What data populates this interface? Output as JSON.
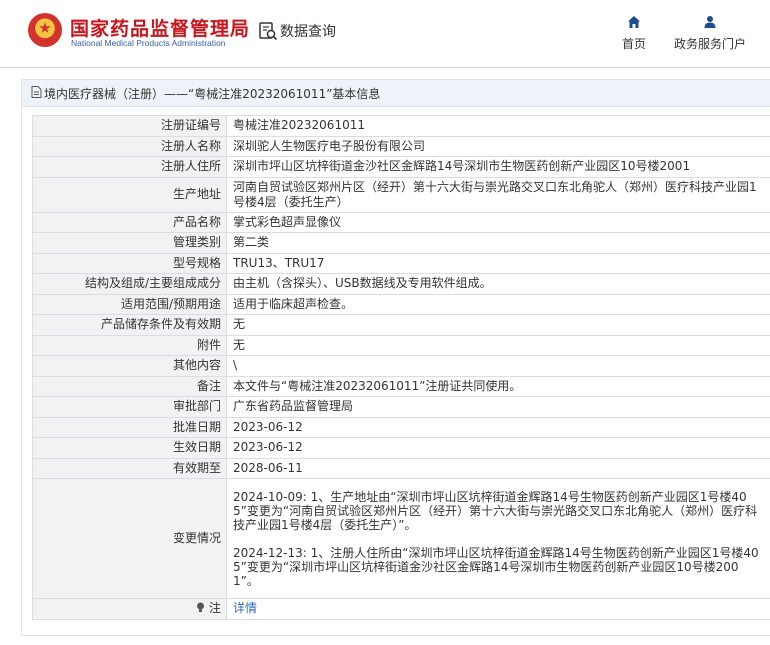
{
  "header": {
    "brand_cn": "国家药品监督管理局",
    "brand_en": "National Medical Products Administration",
    "query_label": "数据查询",
    "nav": [
      {
        "label": "首页",
        "icon": "home-icon"
      },
      {
        "label": "政务服务门户",
        "icon": "user-icon"
      }
    ]
  },
  "colors": {
    "brand_red": "#c8161e",
    "brand_blue": "#3a5fa8",
    "link": "#2f6bb4",
    "panel_head_bg": "#eef3f9",
    "key_bg": "#f2f2f2"
  },
  "panel": {
    "title": "境内医疗器械（注册）——“粤械注准20232061011”基本信息"
  },
  "detail": {
    "rows": [
      {
        "key": "注册证编号",
        "value": "粤械注准20232061011"
      },
      {
        "key": "注册人名称",
        "value": "深圳驼人生物医疗电子股份有限公司"
      },
      {
        "key": "注册人住所",
        "value": "深圳市坪山区坑梓街道金沙社区金辉路14号深圳市生物医药创新产业园区10号楼2001"
      },
      {
        "key": "生产地址",
        "value": "河南自贸试验区郑州片区（经开）第十六大街与崇光路交叉口东北角驼人（郑州）医疗科技产业园1号楼4层（委托生产）"
      },
      {
        "key": "产品名称",
        "value": "掌式彩色超声显像仪"
      },
      {
        "key": "管理类别",
        "value": "第二类"
      },
      {
        "key": "型号规格",
        "value": "TRU13、TRU17"
      },
      {
        "key": "结构及组成/主要组成成分",
        "value": "由主机（含探头）、USB数据线及专用软件组成。"
      },
      {
        "key": "适用范围/预期用途",
        "value": "适用于临床超声检查。"
      },
      {
        "key": "产品储存条件及有效期",
        "value": "无"
      },
      {
        "key": "附件",
        "value": "无"
      },
      {
        "key": "其他内容",
        "value": "\\"
      },
      {
        "key": "备注",
        "value": "本文件与“粤械注准20232061011”注册证共同使用。"
      },
      {
        "key": "审批部门",
        "value": "广东省药品监督管理局"
      },
      {
        "key": "批准日期",
        "value": "2023-06-12"
      },
      {
        "key": "生效日期",
        "value": "2023-06-12"
      },
      {
        "key": "有效期至",
        "value": "2028-06-11"
      }
    ],
    "change": {
      "key": "变更情况",
      "entries": [
        "2024-10-09: 1、生产地址由“深圳市坪山区坑梓街道金辉路14号生物医药创新产业园区1号楼405”变更为“河南自贸试验区郑州片区（经开）第十六大街与崇光路交叉口东北角驼人（郑州）医疗科技产业园1号楼4层（委托生产）”。",
        "2024-12-13: 1、注册人住所由“深圳市坪山区坑梓街道金辉路14号生物医药创新产业园区1号楼405”变更为“深圳市坪山区坑梓街道金沙社区金辉路14号深圳市生物医药创新产业园区10号楼2001”。"
      ]
    },
    "note": {
      "key": "注",
      "icon": "bulb-icon",
      "link": "详情"
    }
  }
}
